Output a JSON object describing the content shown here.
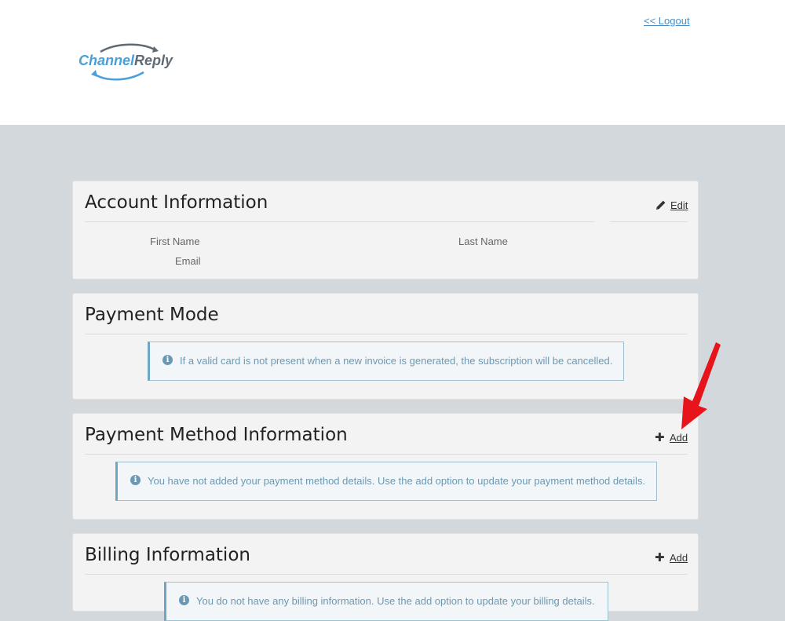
{
  "header": {
    "logout_label": "<< Logout",
    "logo_text_part1": "Channel",
    "logo_text_part2": "Reply"
  },
  "account": {
    "title": "Account Information",
    "edit_label": "Edit",
    "edit_icon": "pencil-icon",
    "fields": {
      "first_name": "First Name",
      "last_name": "Last Name",
      "email": "Email"
    }
  },
  "payment_mode": {
    "title": "Payment Mode",
    "info": "If a valid card is not present when a new invoice is generated, the subscription will be cancelled."
  },
  "payment_method": {
    "title": "Payment Method Information",
    "add_label": "Add",
    "add_icon": "plus-icon",
    "info": "You have not added your payment method details. Use the add option to update your payment method details."
  },
  "billing": {
    "title": "Billing Information",
    "add_label": "Add",
    "add_icon": "plus-icon",
    "info": "You do not have any billing information. Use the add option to update your billing details."
  },
  "icons": {
    "info": "info-icon",
    "pointer": "red-arrow-annotation"
  },
  "colors": {
    "background": "#d3d8dc",
    "card": "#f3f3f3",
    "link_blue": "#4a8fc7",
    "info_text": "#6b99b3",
    "arrow_red": "#e8141c"
  }
}
